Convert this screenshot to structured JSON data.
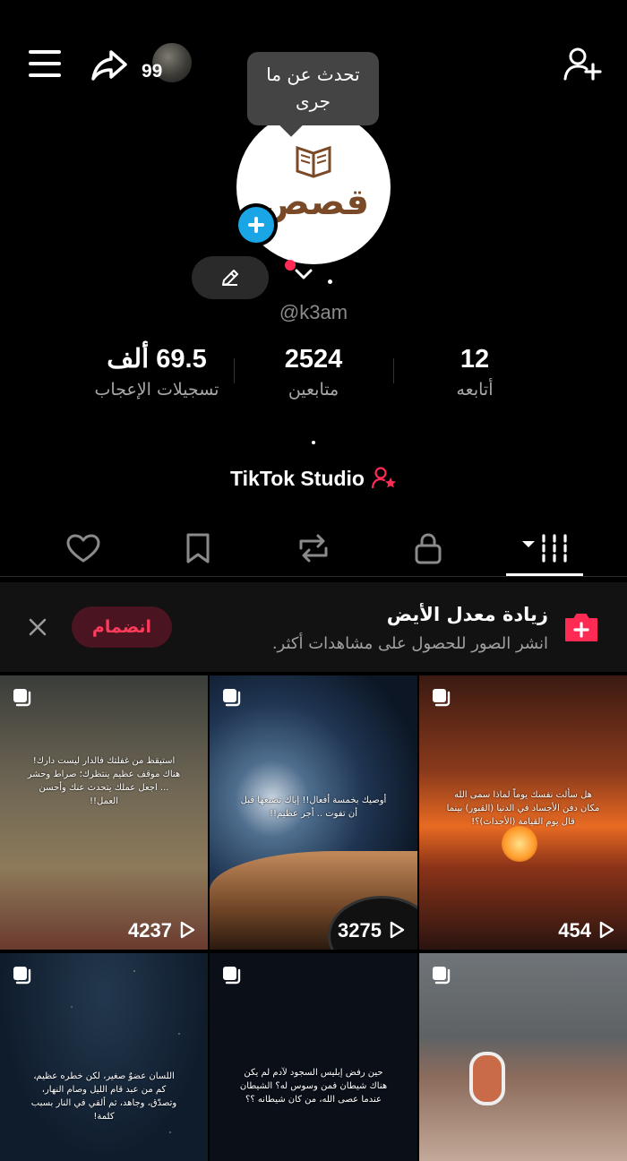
{
  "header": {
    "story_count": "99"
  },
  "tooltip": {
    "text": "تحدث عن ما جرى"
  },
  "profile": {
    "logo_text": "قصص",
    "handle": "@k3am",
    "name_suffix": ".",
    "bio": "."
  },
  "stats": {
    "likes": {
      "value": "69.5 ألف",
      "label": "تسجيلات الإعجاب"
    },
    "followers": {
      "value": "2524",
      "label": "متابعين"
    },
    "following": {
      "value": "12",
      "label": "أتابعه"
    }
  },
  "studio": {
    "label": "TikTok Studio"
  },
  "tabs": [
    "videos-grid",
    "private-lock",
    "reposts",
    "favorites",
    "liked"
  ],
  "banner": {
    "title": "زيادة معدل الأيض",
    "subtitle": "انشر الصور للحصول على مشاهدات أكثر.",
    "join_label": "انضمام"
  },
  "grid": [
    {
      "views": "4237",
      "caption": "استيقظ من غفلتك فالدار ليست دارك! هناك موقف عظيم ينتظرك؛ صراط وحشر ... اجعل عملك يتحدث عنك وأحسن العمل!!"
    },
    {
      "views": "3275",
      "caption": "أوصيك بخمسة أفعال!! إياك تضيعها قبل أن تفوت .. أجر عظيم!!"
    },
    {
      "views": "454",
      "caption": "هل سألت نفسك يوماً لماذا سمى الله مكان دفن الأجساد في الدنيا (القبور) بينما قال يوم القيامة (الأجداث)؟!"
    },
    {
      "views": "",
      "caption": "اللسان عضوٌ صغير، لكن خطره عظيم، كم من عبد قام الليل وصام النهار، وتصدّق، وجاهد، ثم ألقي في النار بسبب كلمة!"
    },
    {
      "views": "",
      "caption": "حين رفض إبليس السجود لآدم لم يكن هناك شيطان فمن وسوس له؟ الشيطان عندما عصى الله، من كان شيطانه ؟؟"
    },
    {
      "views": "",
      "caption": ""
    }
  ],
  "colors": {
    "accent": "#ff2b55",
    "plus_badge": "#1aa6e6",
    "background": "#000000"
  }
}
